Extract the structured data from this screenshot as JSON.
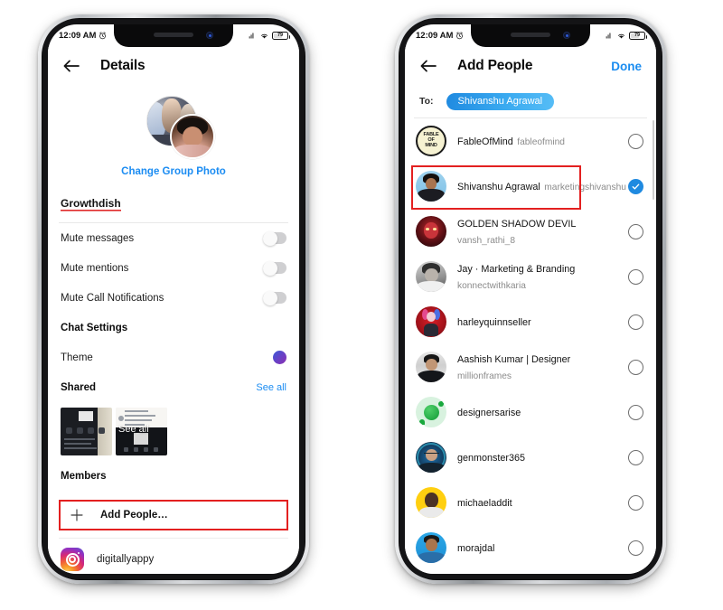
{
  "left_phone": {
    "status": {
      "time": "12:09 AM",
      "alarm_icon": "alarm-icon",
      "signal_icon": "signal-wifi-icon",
      "wifi_icon": "wifi-icon",
      "battery": "79"
    },
    "header": {
      "back_icon": "back-arrow-icon",
      "title": "Details"
    },
    "profile": {
      "change_photo": "Change Group Photo",
      "group_name": "Growthdish"
    },
    "settings_rows": [
      {
        "label": "Mute messages",
        "control": "toggle",
        "state": "off"
      },
      {
        "label": "Mute mentions",
        "control": "toggle",
        "state": "off"
      },
      {
        "label": "Mute Call Notifications",
        "control": "toggle",
        "state": "off"
      }
    ],
    "chat_settings_label": "Chat Settings",
    "theme": {
      "label": "Theme",
      "color": "#6b3fc4"
    },
    "shared": {
      "label": "Shared",
      "see_all": "See all",
      "overlay": "See all"
    },
    "members": {
      "label": "Members",
      "add_people": "Add People…",
      "plus_icon": "plus-icon"
    },
    "member_list": [
      {
        "name": "digitallyappy",
        "avatar": "instagram-logo-icon"
      }
    ],
    "highlight_color": "#e32020"
  },
  "right_phone": {
    "status": {
      "time": "12:09 AM",
      "alarm_icon": "alarm-icon",
      "signal_icon": "signal-wifi-icon",
      "wifi_icon": "wifi-icon",
      "battery": "79"
    },
    "header": {
      "back_icon": "back-arrow-icon",
      "title": "Add People",
      "action": "Done"
    },
    "to_field": {
      "label": "To:",
      "chips": [
        "Shivanshu Agrawal"
      ]
    },
    "people": [
      {
        "name": "FableOfMind",
        "handle": "fableofmind",
        "selected": false,
        "avatar": "fableofmind-avatar"
      },
      {
        "name": "Shivanshu Agrawal",
        "handle": "marketingshivanshu",
        "selected": true,
        "avatar": "shivanshu-avatar"
      },
      {
        "name": "GOLDEN SHADOW DEVIL",
        "handle": "vansh_rathi_8",
        "selected": false,
        "avatar": "devil-avatar"
      },
      {
        "name": "Jay · Marketing & Branding",
        "handle": "konnectwithkaria",
        "selected": false,
        "avatar": "jay-avatar"
      },
      {
        "name": "harleyquinnseller",
        "handle": "",
        "selected": false,
        "avatar": "harley-avatar"
      },
      {
        "name": "Aashish Kumar | Designer",
        "handle": "millionframes",
        "selected": false,
        "avatar": "aashish-avatar"
      },
      {
        "name": "designersarise",
        "handle": "",
        "selected": false,
        "avatar": "designersarise-avatar"
      },
      {
        "name": "genmonster365",
        "handle": "",
        "selected": false,
        "avatar": "genmonster-avatar"
      },
      {
        "name": "michaeladdit",
        "handle": "",
        "selected": false,
        "avatar": "michaeladdit-avatar"
      },
      {
        "name": "morajdal",
        "handle": "",
        "selected": false,
        "avatar": "morajdal-avatar"
      }
    ],
    "accent_color": "#1f8ae0",
    "highlight_color": "#e32020"
  },
  "fable_avatar_text": "FABLE\nOF\nMIND"
}
